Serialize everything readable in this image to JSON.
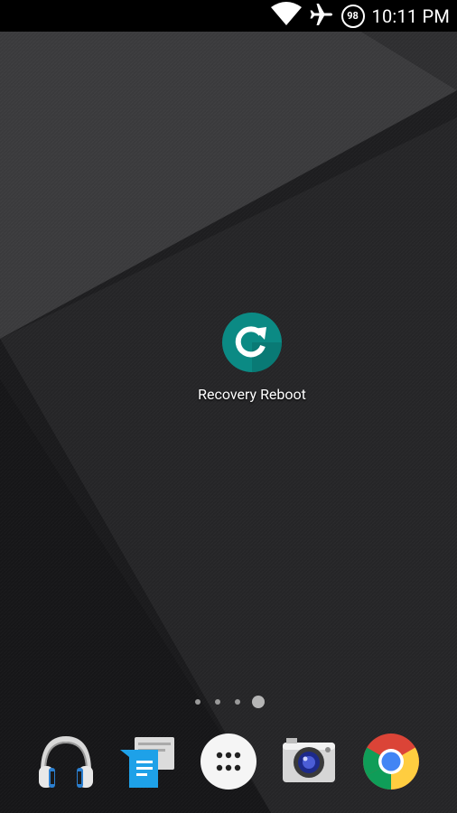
{
  "status_bar": {
    "time": "10:11 PM",
    "battery": "98",
    "icons": [
      "wifi-icon",
      "airplane-mode-icon",
      "battery-icon"
    ]
  },
  "home": {
    "apps": [
      {
        "label": "Recovery Reboot",
        "icon": "recovery-reboot-icon",
        "color": "#0b8a84"
      }
    ],
    "page_count": 4,
    "current_page": 4
  },
  "dock": {
    "items": [
      {
        "name": "music-headphones-icon"
      },
      {
        "name": "messaging-icon",
        "color": "#1ea1e8"
      },
      {
        "name": "all-apps-icon"
      },
      {
        "name": "camera-icon"
      },
      {
        "name": "chrome-icon"
      }
    ]
  },
  "colors": {
    "wallpaper": "#1c1c1e",
    "accent_teal": "#0b8a84",
    "status_bar_bg": "#000000"
  }
}
